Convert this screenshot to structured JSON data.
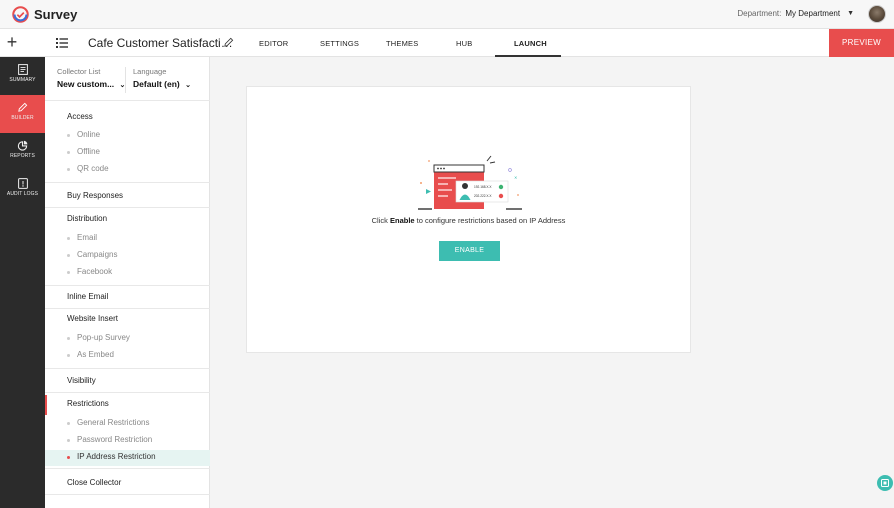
{
  "app": {
    "name": "Survey"
  },
  "topbar": {
    "department_label": "Department:",
    "department_value": "My Department"
  },
  "navbar": {
    "survey_title": "Cafe Customer Satisfacti…",
    "tabs": [
      "EDITOR",
      "SETTINGS",
      "THEMES",
      "HUB",
      "LAUNCH"
    ],
    "active_tab": "LAUNCH",
    "preview_label": "PREVIEW"
  },
  "rail": {
    "items": [
      {
        "label": "SUMMARY",
        "icon": "summary-icon"
      },
      {
        "label": "BUILDER",
        "icon": "pencil-icon",
        "active": true
      },
      {
        "label": "REPORTS",
        "icon": "pie-chart-icon"
      },
      {
        "label": "AUDIT LOGS",
        "icon": "audit-log-icon"
      }
    ]
  },
  "panel": {
    "collector_label": "Collector List",
    "collector_value": "New custom...",
    "language_label": "Language",
    "language_value": "Default (en)",
    "sections": {
      "access": {
        "title": "Access",
        "items": [
          "Online",
          "Offline",
          "QR code"
        ]
      },
      "buy_responses": {
        "title": "Buy Responses"
      },
      "distribution": {
        "title": "Distribution",
        "items": [
          "Email",
          "Campaigns",
          "Facebook"
        ]
      },
      "inline_email": {
        "title": "Inline Email"
      },
      "website_insert": {
        "title": "Website Insert",
        "items": [
          "Pop-up Survey",
          "As Embed"
        ]
      },
      "visibility": {
        "title": "Visibility"
      },
      "restrictions": {
        "title": "Restrictions",
        "items": [
          "General Restrictions",
          "Password Restriction",
          "IP Address Restriction"
        ],
        "active_item": "IP Address Restriction"
      },
      "close_collector": {
        "title": "Close Collector"
      }
    }
  },
  "main": {
    "message_prefix": "Click ",
    "message_bold": "Enable",
    "message_suffix": " to configure restrictions based on IP Address",
    "enable_label": "ENABLE",
    "illustration": {
      "ip_allowed": "192.168.X.X",
      "ip_blocked": "202.222.X.X"
    }
  },
  "colors": {
    "accent_red": "#e84d4d",
    "accent_teal": "#3dbdb1",
    "rail_bg": "#2b2b2b"
  }
}
